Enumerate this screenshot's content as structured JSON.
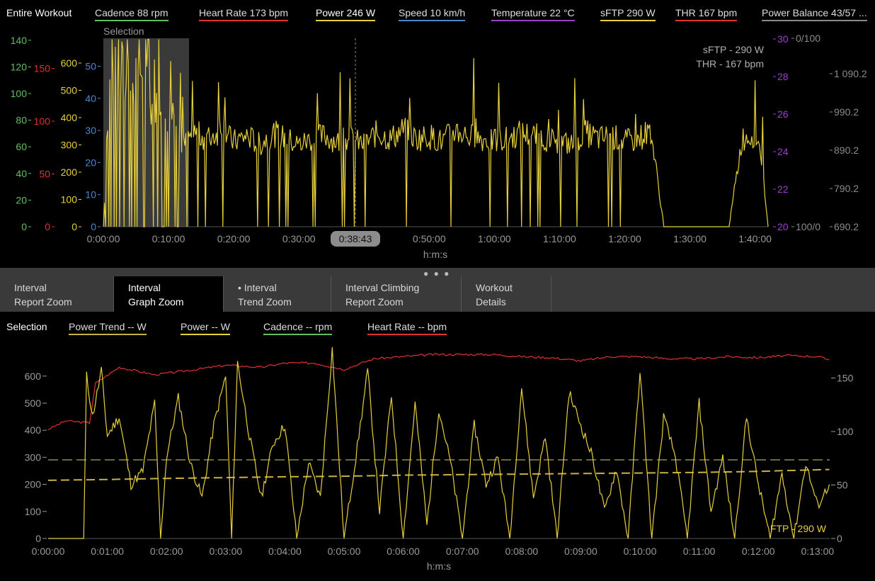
{
  "header": {
    "scope_label": "Entire Workout",
    "metrics": [
      {
        "label": "Cadence  88 rpm",
        "color": "#5fbf5f"
      },
      {
        "label": "Heart Rate  173 bpm",
        "color": "#e03030"
      },
      {
        "label": "Power  246 W",
        "color": "#e6cf3c"
      },
      {
        "label": "Speed  10 km/h",
        "color": "#4a86d0"
      },
      {
        "label": "Temperature  22 °C",
        "color": "#9a40c8"
      },
      {
        "label": "sFTP  290 W",
        "color": "#e6cf3c"
      },
      {
        "label": "THR  167 bpm",
        "color": "#e03030"
      },
      {
        "label": "Power Balance  43/57 ...",
        "color": "#8a8a8a"
      }
    ]
  },
  "top_chart": {
    "selection_label": "Selection",
    "annotation_ftp": "sFTP - 290 W",
    "annotation_thr": "THR - 167 bpm",
    "cursor_time": "0:38:43",
    "xlabel": "h:m:s"
  },
  "tabs": [
    {
      "line1": "Interval",
      "line2": "Report Zoom"
    },
    {
      "line1": "Interval",
      "line2": "Graph Zoom"
    },
    {
      "line1": "• Interval",
      "line2": "Trend Zoom"
    },
    {
      "line1": "Interval Climbing",
      "line2": "Report Zoom"
    },
    {
      "line1": "Workout",
      "line2": "Details"
    }
  ],
  "active_tab": 1,
  "bottom_legend": {
    "scope_label": "Selection",
    "items": [
      {
        "label": "Power Trend  -- W",
        "color": "#c9b040"
      },
      {
        "label": "Power  -- W",
        "color": "#e6cf3c"
      },
      {
        "label": "Cadence  -- rpm",
        "color": "#5fbf5f"
      },
      {
        "label": "Heart Rate  -- bpm",
        "color": "#e03030"
      }
    ]
  },
  "bottom_chart": {
    "ftp_label": "FTP - 290 W",
    "xlabel": "h:m:s"
  },
  "colors": {
    "power": "#e6cf3c",
    "heart_rate": "#e03030",
    "cadence": "#5fbf5f",
    "speed": "#4a86d0",
    "temperature": "#9a40c8",
    "ftp_line": "#6b6a2a",
    "trend": "#c9b040"
  },
  "chart_data": [
    {
      "type": "line",
      "title": "Entire Workout",
      "xlabel": "h:m:s",
      "x_ticks": [
        "0:00:00",
        "0:10:00",
        "0:20:00",
        "0:30:00",
        "0:40:00",
        "0:50:00",
        "1:00:00",
        "1:10:00",
        "1:20:00",
        "1:30:00",
        "1:40:00"
      ],
      "xlim_minutes": [
        0,
        102
      ],
      "axes": [
        {
          "name": "cadence",
          "ticks": [
            "0",
            "20",
            "40",
            "60",
            "80",
            "100",
            "120",
            "140"
          ],
          "color": "#5fbf5f"
        },
        {
          "name": "heart_rate",
          "ticks": [
            "0",
            "50",
            "100",
            "150"
          ],
          "color": "#e03030"
        },
        {
          "name": "power",
          "ticks": [
            "0",
            "100",
            "200",
            "300",
            "400",
            "500",
            "600"
          ],
          "color": "#e6cf3c"
        },
        {
          "name": "speed",
          "ticks": [
            "0",
            "10",
            "20",
            "30",
            "40",
            "50"
          ],
          "color": "#4a86d0"
        },
        {
          "name": "temperature",
          "ticks": [
            "20",
            "22",
            "24",
            "26",
            "28",
            "30"
          ],
          "color": "#9a40c8"
        },
        {
          "name": "power_balance",
          "ticks": [
            "100/0",
            "0/100"
          ],
          "color": "#8a8a8a"
        },
        {
          "name": "elevation",
          "ticks": [
            "690.2",
            "790.2",
            "890.2",
            "990.2",
            "1 090.2"
          ],
          "color": "#8a8a8a"
        }
      ],
      "selection_minutes": [
        0,
        13
      ],
      "cursor_minutes": 38.7,
      "series": [
        {
          "name": "Power",
          "x_minutes": [
            0,
            1,
            2,
            3,
            4,
            5,
            6,
            7,
            8,
            9,
            10,
            11,
            12,
            13,
            14,
            16,
            18,
            20,
            22,
            24,
            26,
            28,
            30,
            32,
            34,
            36,
            38,
            40,
            42,
            44,
            46,
            48,
            50,
            52,
            54,
            56,
            58,
            60,
            62,
            64,
            66,
            68,
            70,
            72,
            74,
            76,
            78,
            80,
            82,
            84,
            86,
            88,
            90,
            92,
            94,
            96,
            98,
            100,
            101,
            102
          ],
          "values": [
            0,
            480,
            550,
            420,
            560,
            380,
            500,
            430,
            320,
            480,
            350,
            420,
            260,
            300,
            320,
            300,
            330,
            290,
            310,
            280,
            320,
            300,
            280,
            300,
            310,
            290,
            300,
            280,
            320,
            300,
            330,
            300,
            310,
            290,
            330,
            310,
            300,
            290,
            300,
            320,
            310,
            300,
            290,
            280,
            320,
            300,
            310,
            290,
            300,
            330,
            0,
            0,
            0,
            0,
            0,
            0,
            300,
            320,
            240,
            0
          ]
        }
      ]
    },
    {
      "type": "line",
      "title": "Selection",
      "xlabel": "h:m:s",
      "x_ticks": [
        "0:00:00",
        "0:01:00",
        "0:02:00",
        "0:03:00",
        "0:04:00",
        "0:05:00",
        "0:06:00",
        "0:07:00",
        "0:08:00",
        "0:09:00",
        "0:10:00",
        "0:11:00",
        "0:12:00",
        "0:13:00"
      ],
      "y_left_ticks": [
        "0",
        "100",
        "200",
        "300",
        "400",
        "500",
        "600"
      ],
      "y_right_ticks": [
        "0",
        "50",
        "100",
        "150"
      ],
      "ylim_left": [
        0,
        700
      ],
      "ylim_right": [
        0,
        180
      ],
      "ftp_watts": 290,
      "series": [
        {
          "name": "Heart Rate",
          "x_minutes": [
            0,
            0.3,
            0.7,
            0.8,
            1.2,
            1.8,
            2.5,
            3.0,
            3.6,
            4.0,
            4.5,
            5.0,
            5.5,
            6.0,
            6.5,
            7.0,
            7.5,
            8.0,
            8.5,
            9.0,
            9.5,
            10.0,
            10.5,
            11.0,
            11.5,
            12.0,
            12.5,
            13.0,
            13.2
          ],
          "values": [
            102,
            110,
            108,
            145,
            160,
            153,
            158,
            162,
            160,
            164,
            164,
            158,
            168,
            170,
            172,
            172,
            172,
            170,
            169,
            166,
            170,
            170,
            168,
            168,
            170,
            169,
            171,
            170,
            167
          ]
        },
        {
          "name": "Power Trend",
          "x_minutes": [
            0,
            1,
            2,
            3,
            4,
            5,
            6,
            7,
            8,
            9,
            10,
            11,
            12,
            13.2
          ],
          "values": [
            215,
            218,
            222,
            225,
            228,
            230,
            234,
            236,
            238,
            240,
            242,
            244,
            248,
            255
          ]
        },
        {
          "name": "Power",
          "x_minutes": [
            0,
            0.6,
            0.65,
            0.75,
            0.9,
            1.0,
            1.2,
            1.4,
            1.6,
            1.8,
            1.9,
            2.0,
            2.2,
            2.4,
            2.6,
            2.8,
            3.0,
            3.1,
            3.2,
            3.4,
            3.6,
            3.8,
            4.0,
            4.2,
            4.4,
            4.6,
            4.8,
            5.0,
            5.2,
            5.4,
            5.6,
            5.8,
            6.0,
            6.2,
            6.4,
            6.6,
            6.8,
            7.0,
            7.2,
            7.4,
            7.6,
            7.8,
            8.0,
            8.2,
            8.4,
            8.6,
            8.8,
            9.0,
            9.2,
            9.4,
            9.6,
            9.8,
            10.0,
            10.2,
            10.4,
            10.6,
            10.8,
            11.0,
            11.2,
            11.4,
            11.6,
            11.8,
            12.0,
            12.2,
            12.4,
            12.6,
            12.8,
            13.0,
            13.2
          ],
          "values": [
            0,
            0,
            600,
            450,
            620,
            380,
            450,
            200,
            250,
            500,
            0,
            300,
            520,
            280,
            150,
            420,
            600,
            0,
            650,
            380,
            150,
            350,
            420,
            0,
            280,
            150,
            700,
            0,
            300,
            620,
            100,
            530,
            0,
            500,
            50,
            480,
            280,
            0,
            420,
            200,
            300,
            0,
            560,
            150,
            380,
            0,
            540,
            420,
            300,
            100,
            260,
            0,
            620,
            0,
            450,
            300,
            0,
            500,
            100,
            300,
            0,
            450,
            200,
            0,
            240,
            0,
            280,
            120,
            200
          ]
        }
      ]
    }
  ]
}
